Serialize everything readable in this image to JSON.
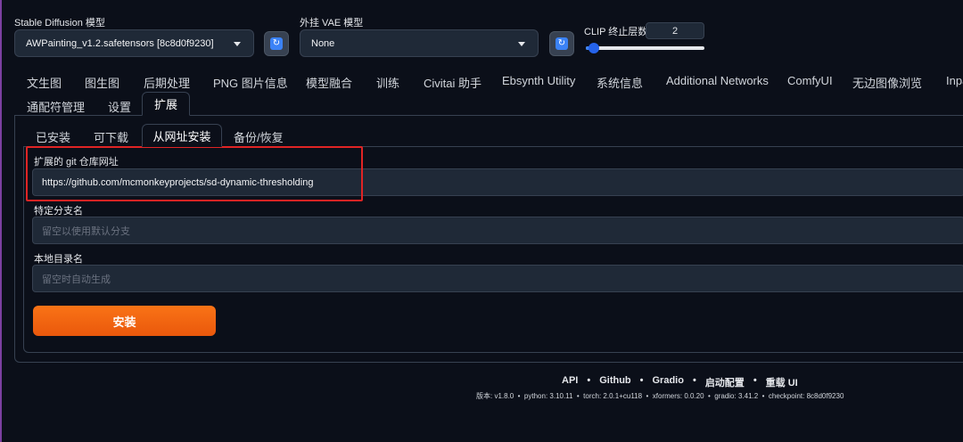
{
  "top": {
    "sd_model_label": "Stable Diffusion 模型",
    "sd_model_value": "AWPainting_v1.2.safetensors [8c8d0f9230]",
    "vae_label": "外挂 VAE 模型",
    "vae_value": "None",
    "clip_label": "CLIP 终止层数",
    "clip_value": "2",
    "clip_slider_fraction": 0.08
  },
  "main_tabs_row1": [
    "文生图",
    "图生图",
    "后期处理",
    "PNG 图片信息",
    "模型融合",
    "训练",
    "Civitai 助手",
    "Ebsynth Utility",
    "系统信息",
    "Additional Networks",
    "ComfyUI",
    "无边图像浏览",
    "Inpa"
  ],
  "main_tabs_row2": [
    "通配符管理",
    "设置",
    "扩展"
  ],
  "active_main_tab": "扩展",
  "sub_tabs": [
    "已安装",
    "可下载",
    "从网址安装",
    "备份/恢复"
  ],
  "active_sub_tab": "从网址安装",
  "form": {
    "git_url_label": "扩展的 git 仓库网址",
    "git_url_value": "https://github.com/mcmonkeyprojects/sd-dynamic-thresholding",
    "branch_label": "特定分支名",
    "branch_placeholder": "留空以使用默认分支",
    "dir_label": "本地目录名",
    "dir_placeholder": "留空时自动生成",
    "install_button": "安装"
  },
  "footer": {
    "links": [
      "API",
      "Github",
      "Gradio",
      "启动配置",
      "重载 UI"
    ],
    "separator": "•",
    "version_info": "版本: v1.8.0  •  python: 3.10.11  •  torch: 2.0.1+cu118  •  xformers: 0.0.20  •  gradio: 3.41.2  •  checkpoint: 8c8d0f9230"
  },
  "colors": {
    "background": "#0b0f19",
    "accent_orange": "#f97316",
    "highlight_red": "#e02424",
    "refresh_blue": "#3b82f6"
  }
}
